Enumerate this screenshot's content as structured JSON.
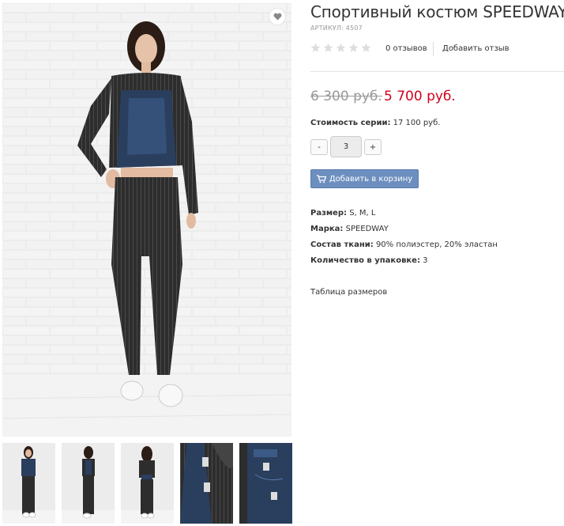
{
  "product": {
    "title": "Спортивный костюм SPEEDWAY",
    "sku": "АРТИКУЛ: 4507",
    "rating": 0,
    "reviews_count": "0 отзывов",
    "add_review": "Добавить отзыв",
    "old_price": "6 300 руб.",
    "new_price": "5 700 руб.",
    "series_label": "Стоимость серии:",
    "series_value": "17 100 руб.",
    "quantity": "3",
    "qty_minus": "-",
    "qty_plus": "+",
    "cart_button": "Добавить в корзину",
    "properties": [
      {
        "label": "Размер:",
        "value": "S, M, L"
      },
      {
        "label": "Марка:",
        "value": "SPEEDWAY"
      },
      {
        "label": "Состав ткани:",
        "value": "90% полиэстер, 20% эластан"
      },
      {
        "label": "Количество в упаковке:",
        "value": "3"
      }
    ],
    "size_table": "Таблица размеров"
  },
  "icons": {
    "favorite": "heart-icon",
    "cart": "cart-icon",
    "star": "star-icon"
  },
  "colors": {
    "price_new": "#d0021b",
    "price_old": "#999999",
    "cart_button": "#6d8fbf",
    "star_empty": "#dddddd"
  }
}
